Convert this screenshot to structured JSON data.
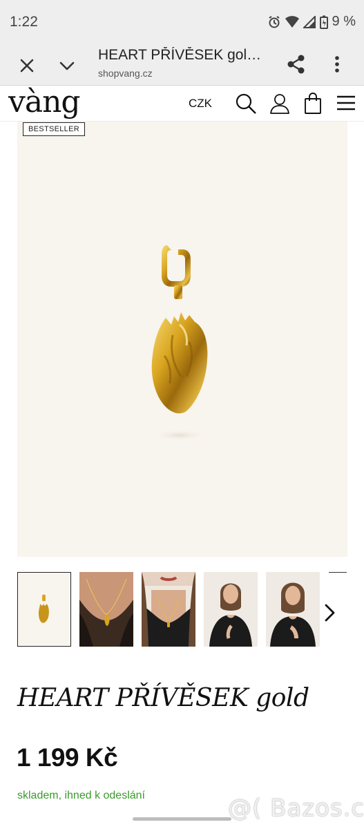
{
  "status_bar": {
    "time": "1:22",
    "battery": "9 %",
    "icons": [
      "alarm-icon",
      "wifi-icon",
      "signal-icon",
      "battery-icon"
    ]
  },
  "browser": {
    "page_title": "HEART PŘÍVĚSEK gol…",
    "url": "shopvang.cz",
    "icons": [
      "close-icon",
      "chevron-down-icon",
      "share-icon",
      "more-vert-icon"
    ]
  },
  "header": {
    "logo": "vàng",
    "currency": "CZK",
    "icons": [
      "search-icon",
      "user-icon",
      "bag-icon",
      "menu-icon"
    ]
  },
  "product": {
    "badge": "BESTSELLER",
    "title": "HEART PŘÍVĚSEK gold",
    "price": "1 199 Kč",
    "availability": "skladem, ihned k odeslání",
    "thumbnails": [
      "product-only",
      "necklace-closeup",
      "model-neck",
      "model-portrait",
      "model-portrait-2"
    ]
  },
  "watermark": "@( Bazos.cz",
  "colors": {
    "gold": "#d9a520",
    "stock_green": "#3a9a2c",
    "image_bg": "#f8f4ee",
    "chrome_bg": "#eeeeee"
  }
}
